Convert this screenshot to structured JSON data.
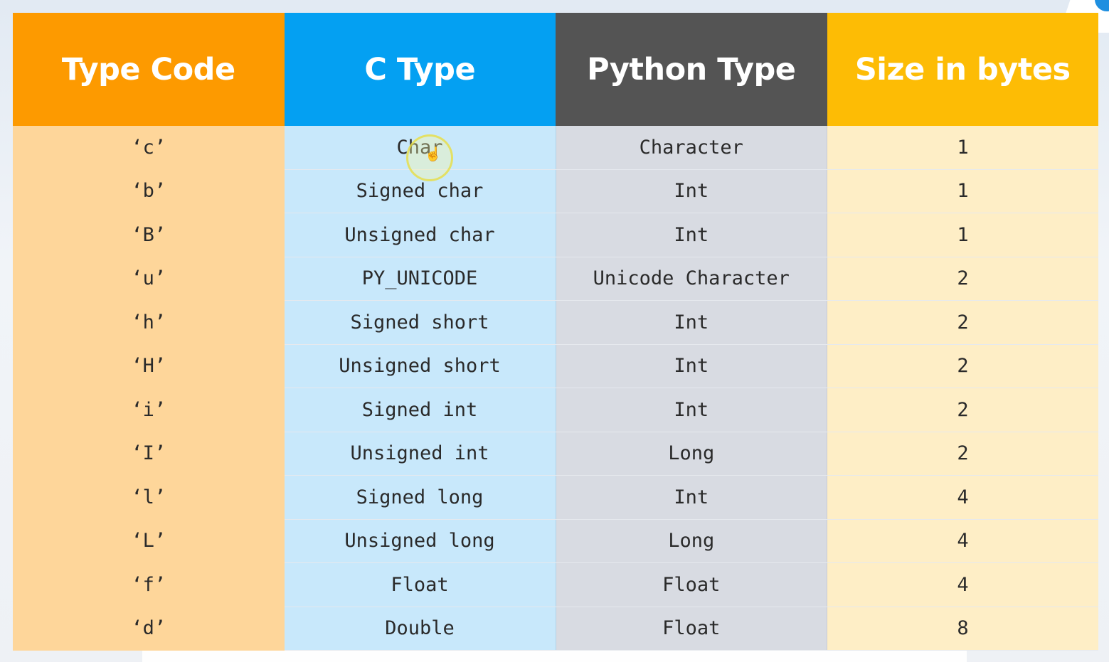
{
  "table": {
    "headers": [
      "Type Code",
      "C Type",
      "Python Type",
      "Size in bytes"
    ],
    "rows": [
      [
        "‘c’",
        "Char",
        "Character",
        "1"
      ],
      [
        "‘b’",
        "Signed char",
        "Int",
        "1"
      ],
      [
        "‘B’",
        "Unsigned char",
        "Int",
        "1"
      ],
      [
        "‘u’",
        "PY_UNICODE",
        "Unicode Character",
        "2"
      ],
      [
        "‘h’",
        "Signed short",
        "Int",
        "2"
      ],
      [
        "‘H’",
        "Unsigned short",
        "Int",
        "2"
      ],
      [
        "‘i’",
        "Signed int",
        "Int",
        "2"
      ],
      [
        "‘I’",
        "Unsigned int",
        "Long",
        "2"
      ],
      [
        "‘l’",
        "Signed long",
        "Int",
        "4"
      ],
      [
        "‘L’",
        "Unsigned long",
        "Long",
        "4"
      ],
      [
        "‘f’",
        "Float",
        "Float",
        "4"
      ],
      [
        "‘d’",
        "Double",
        "Float",
        "8"
      ]
    ]
  },
  "colors": {
    "type_code_header": "#fd9a00",
    "c_type_header": "#04a0f2",
    "python_type_header": "#545454",
    "size_header": "#fdbc05"
  },
  "cursor": {
    "icon": "hand-pointer-icon"
  }
}
